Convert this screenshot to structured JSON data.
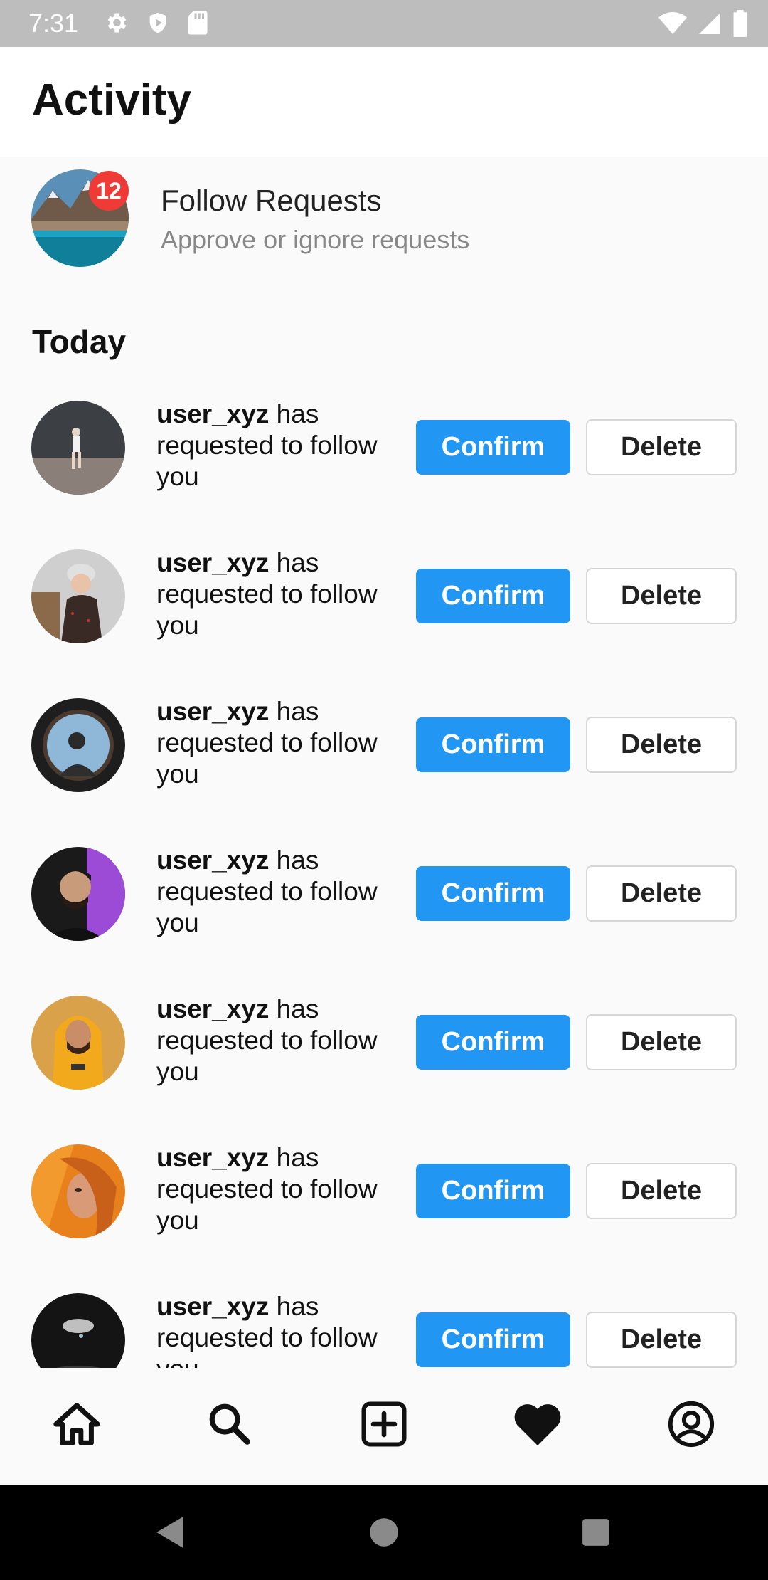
{
  "status_bar": {
    "time": "7:31",
    "left_icons": [
      "gear-icon",
      "shield-play-icon",
      "sd-card-icon"
    ],
    "right_icons": [
      "wifi-icon",
      "signal-icon",
      "battery-icon"
    ]
  },
  "header": {
    "title": "Activity"
  },
  "follow_requests": {
    "title": "Follow Requests",
    "subtitle": "Approve or ignore requests",
    "badge_count": "12",
    "badge_color": "#ef3b36"
  },
  "section": {
    "heading": "Today"
  },
  "requests": [
    {
      "username": "user_xyz",
      "message": " has requested to follow you",
      "confirm_label": "Confirm",
      "delete_label": "Delete"
    },
    {
      "username": "user_xyz",
      "message": " has requested to follow you",
      "confirm_label": "Confirm",
      "delete_label": "Delete"
    },
    {
      "username": "user_xyz",
      "message": " has requested to follow you",
      "confirm_label": "Confirm",
      "delete_label": "Delete"
    },
    {
      "username": "user_xyz",
      "message": " has requested to follow you",
      "confirm_label": "Confirm",
      "delete_label": "Delete"
    },
    {
      "username": "user_xyz",
      "message": " has requested to follow you",
      "confirm_label": "Confirm",
      "delete_label": "Delete"
    },
    {
      "username": "user_xyz",
      "message": " has requested to follow you",
      "confirm_label": "Confirm",
      "delete_label": "Delete"
    },
    {
      "username": "user_xyz",
      "message": " has requested to follow you",
      "confirm_label": "Confirm",
      "delete_label": "Delete"
    }
  ],
  "bottom_nav": [
    "home-icon",
    "search-icon",
    "add-post-icon",
    "heart-icon",
    "profile-icon"
  ],
  "system_nav": [
    "back-icon",
    "home-circle-icon",
    "recents-icon"
  ],
  "colors": {
    "accent": "#2196f3",
    "background": "#fafafa"
  }
}
